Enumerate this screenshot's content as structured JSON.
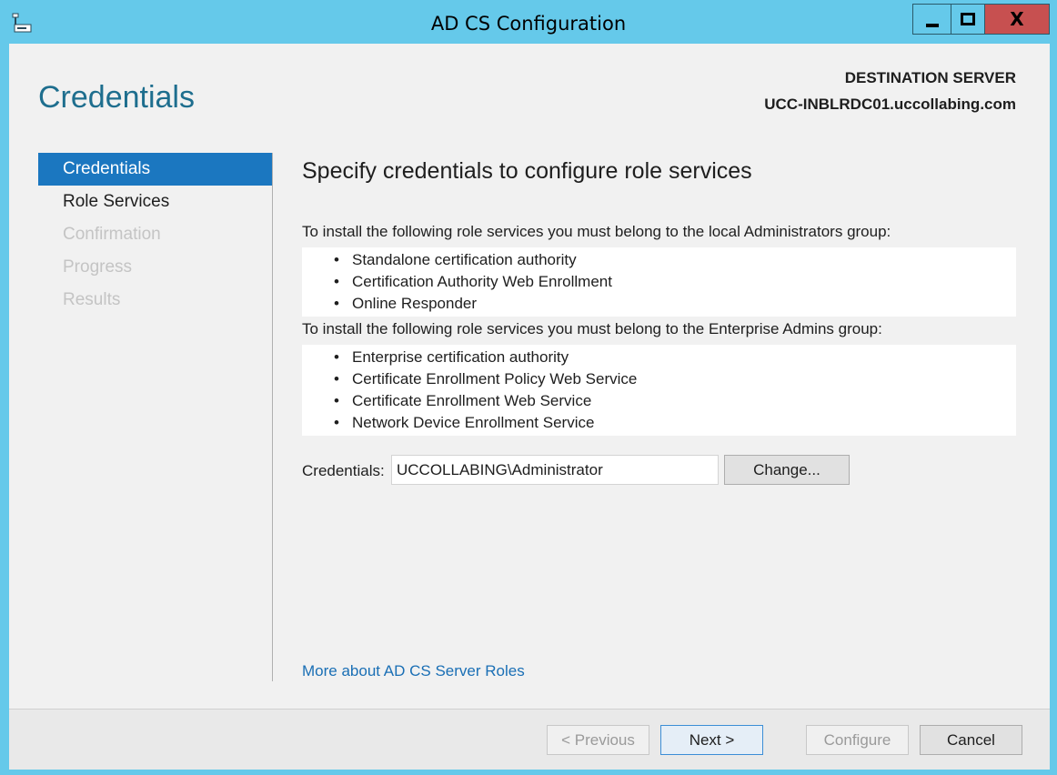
{
  "window": {
    "title": "AD CS Configuration",
    "close_glyph": "X"
  },
  "header": {
    "page_title": "Credentials",
    "destination_label": "DESTINATION SERVER",
    "destination_server": "UCC-INBLRDC01.uccollabing.com"
  },
  "nav": {
    "items": [
      {
        "label": "Credentials",
        "state": "active"
      },
      {
        "label": "Role Services",
        "state": "enabled"
      },
      {
        "label": "Confirmation",
        "state": "disabled"
      },
      {
        "label": "Progress",
        "state": "disabled"
      },
      {
        "label": "Results",
        "state": "disabled"
      }
    ]
  },
  "main": {
    "heading": "Specify credentials to configure role services",
    "local_admin_text": "To install the following role services you must belong to the local Administrators group:",
    "local_admin_services": [
      "Standalone certification authority",
      "Certification Authority Web Enrollment",
      "Online Responder"
    ],
    "enterprise_admin_text": "To install the following role services you must belong to the Enterprise Admins group:",
    "enterprise_admin_services": [
      "Enterprise certification authority",
      "Certificate Enrollment Policy Web Service",
      "Certificate Enrollment Web Service",
      "Network Device Enrollment Service"
    ],
    "bullet": "•",
    "credentials_label": "Credentials:",
    "credentials_value": "UCCOLLABING\\Administrator",
    "change_button": "Change...",
    "more_link": "More about AD CS Server Roles"
  },
  "footer": {
    "previous": "< Previous",
    "next": "Next >",
    "configure": "Configure",
    "cancel": "Cancel"
  },
  "colors": {
    "title_bar": "#65c9ea",
    "accent": "#1b77c0",
    "close_button": "#c75050",
    "link": "#1a6fb5"
  }
}
